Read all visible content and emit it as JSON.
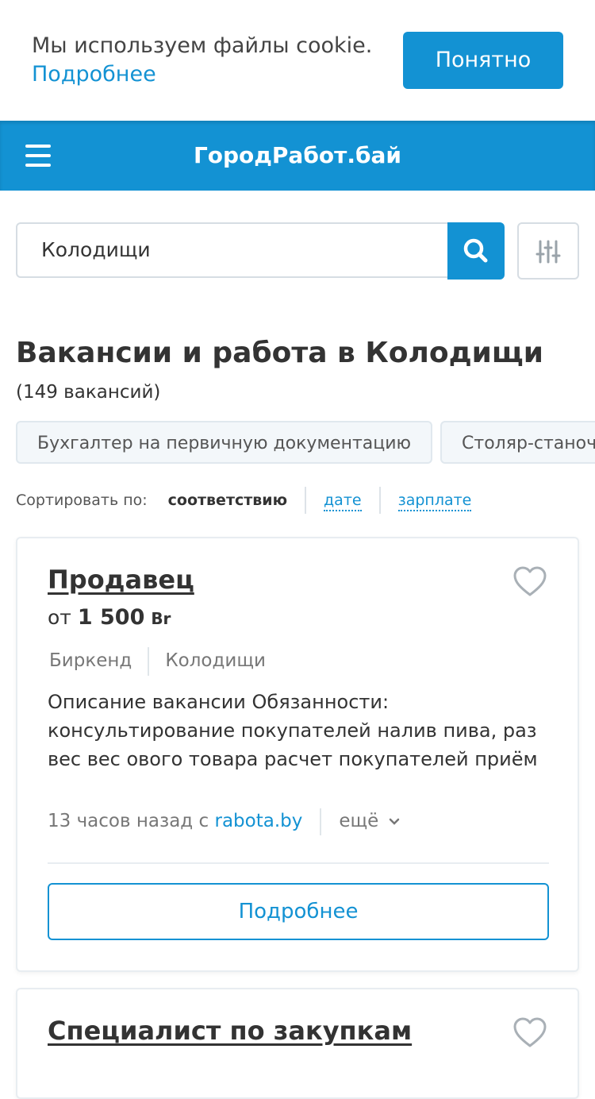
{
  "cookie": {
    "text": "Мы используем файлы cookie.",
    "link": "Подробнее",
    "accept_button": "Понятно"
  },
  "header": {
    "brand": "ГородРабот.бай"
  },
  "search": {
    "query": "Колодищи"
  },
  "page": {
    "title": "Вакансии и работа в Колодищи",
    "count": "(149 вакансий)"
  },
  "chips": [
    "Бухгалтер на первичную документацию",
    "Столяр-станочник"
  ],
  "sort": {
    "label": "Сортировать по:",
    "options": [
      "соответствию",
      "дате",
      "зарплате"
    ],
    "active": "соответствию"
  },
  "jobs": [
    {
      "title": "Продавец",
      "salary_prefix": "от",
      "salary_amount": "1 500",
      "salary_currency": "Br",
      "company": "Биркенд",
      "location": "Колодищи",
      "description": "Описание вакансии Обязанности: консультирование покупателей налив пива, раз вес вес ового товара расчет покупателей приём",
      "posted": "13 часов назад с",
      "source": "rabota.by",
      "more_menu": "ещё",
      "details_button": "Подробнее"
    },
    {
      "title": "Специалист по закупкам"
    }
  ],
  "colors": {
    "accent": "#1392d3",
    "text": "#333333",
    "muted": "#777777"
  },
  "icons": {
    "menu": "menu-icon",
    "search": "search-icon",
    "filter": "filter-icon",
    "favorite": "heart-icon",
    "more": "chevron-down-icon"
  }
}
